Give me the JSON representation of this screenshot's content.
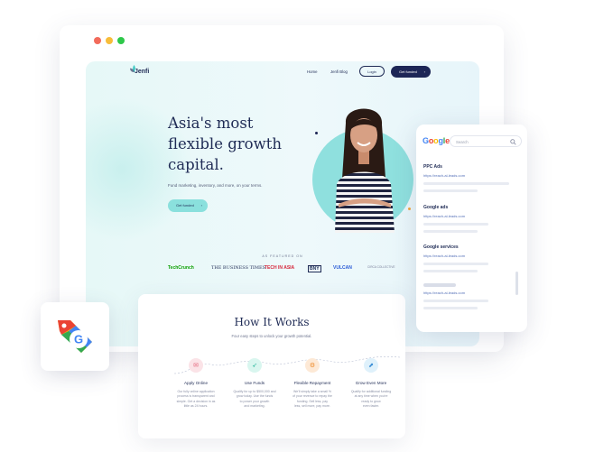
{
  "window": {
    "dot_colors": [
      "#f26b5b",
      "#f7bd3a",
      "#2ec84a"
    ]
  },
  "nav": {
    "logo": "Jenfi",
    "links": [
      "Home",
      "Jenfi Blog"
    ],
    "login": "Login",
    "get_funded": "Get funded"
  },
  "hero": {
    "headline_lines": [
      "Asia's most",
      "flexible growth",
      "capital."
    ],
    "subtext": "Fund marketing, inventory, and more, on your terms.",
    "cta": "Get funded"
  },
  "featured": {
    "label": "AS FEATURED ON",
    "logos": [
      "TechCrunch",
      "THE BUSINESS TIMES",
      "TECH IN ASIA",
      "BNY",
      "VULCAN",
      "CIRCA COLLECTIVE"
    ]
  },
  "how": {
    "title": "How It Works",
    "subtitle": "Four easy steps to unlock your growth potential.",
    "steps": [
      {
        "title": "Apply Online",
        "icon": "envelope-icon",
        "color": "#fbe3e7",
        "text": [
          "Our fully online application",
          "process is transparent and",
          "simple. Get a decision in as",
          "little as 24 hours."
        ]
      },
      {
        "title": "Use Funds",
        "icon": "rocket-icon",
        "color": "#d9f6ef",
        "text": [
          "Qualify for up to $500,000 and",
          "grow today. Use the funds",
          "to power your growth",
          "and marketing."
        ]
      },
      {
        "title": "Flexible Repayment",
        "icon": "chart-icon",
        "color": "#fde9d6",
        "text": [
          "We'll simply take a small %",
          "of your revenue to repay the",
          "funding. Sell less, pay",
          "less, sell more, pay more."
        ]
      },
      {
        "title": "Grow Even More",
        "icon": "growth-icon",
        "color": "#dff1fb",
        "text": [
          "Qualify for additional funding",
          "at any time when you're",
          "ready to grow",
          "even faster."
        ]
      }
    ]
  },
  "google_panel": {
    "logo_letters": [
      {
        "ch": "G",
        "color": "#4285F4"
      },
      {
        "ch": "o",
        "color": "#EA4335"
      },
      {
        "ch": "o",
        "color": "#FBBC05"
      },
      {
        "ch": "g",
        "color": "#4285F4"
      },
      {
        "ch": "l",
        "color": "#34A853"
      },
      {
        "ch": "e",
        "color": "#EA4335"
      }
    ],
    "search_placeholder": "Search",
    "results": [
      {
        "title": "PPC Ads",
        "url": "https://reach-al-leads.com"
      },
      {
        "title": "Google ads",
        "url": "https://reach-al-leads.com"
      },
      {
        "title": "Google services",
        "url": "https://reach-al-leads.com"
      },
      {
        "title": "",
        "url": "https://reach-al-leads.com"
      }
    ]
  },
  "accent": {
    "navy": "#1d2656",
    "teal": "#8fe0de"
  }
}
